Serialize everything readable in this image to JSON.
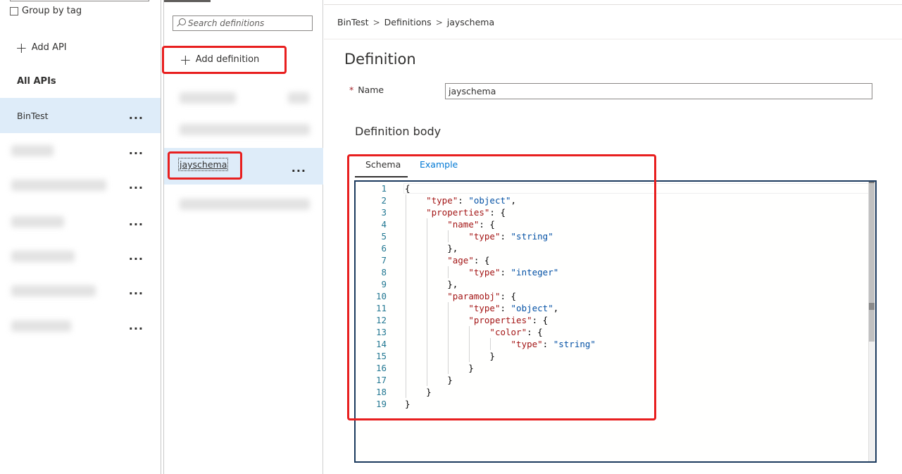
{
  "api_pane": {
    "group_by_tag": "Group by tag",
    "add_api": "Add API",
    "all_apis": "All APIs",
    "apis": [
      {
        "name": "BinTest",
        "more": "...",
        "selected": true
      },
      {
        "name": "",
        "more": "..."
      },
      {
        "name": "",
        "more": "..."
      },
      {
        "name": "",
        "more": "..."
      },
      {
        "name": "",
        "more": "..."
      },
      {
        "name": "",
        "more": "..."
      },
      {
        "name": "",
        "more": "..."
      }
    ]
  },
  "definitions_pane": {
    "search_placeholder": "Search definitions",
    "add_definition": "Add definition",
    "items": [
      {
        "name": "",
        "more": ""
      },
      {
        "name": "",
        "more": ""
      },
      {
        "name": "jayschema",
        "more": "...",
        "selected": true
      },
      {
        "name": "",
        "more": ""
      }
    ]
  },
  "detail": {
    "breadcrumb": [
      "BinTest",
      "Definitions",
      "jayschema"
    ],
    "breadcrumb_sep": ">",
    "title": "Definition",
    "name_label": "Name",
    "required_mark": "*",
    "name_value": "jayschema",
    "body_title": "Definition body",
    "tabs": [
      "Schema",
      "Example"
    ],
    "active_tab": "Schema",
    "editor_lines": [
      "{",
      "    \"type\": \"object\",",
      "    \"properties\": {",
      "        \"name\": {",
      "            \"type\": \"string\"",
      "        },",
      "        \"age\": {",
      "            \"type\": \"integer\"",
      "        },",
      "        \"paramobj\": {",
      "            \"type\": \"object\",",
      "            \"properties\": {",
      "                \"color\": {",
      "                    \"type\": \"string\"",
      "                }",
      "            }",
      "        }",
      "    }",
      "}"
    ]
  },
  "colors": {
    "selected_row": "#deecf9",
    "link_blue": "#0078d4",
    "annotation_red": "#e81f1f",
    "json_key": "#a31515",
    "json_string": "#0451a5",
    "line_number": "#237893"
  }
}
